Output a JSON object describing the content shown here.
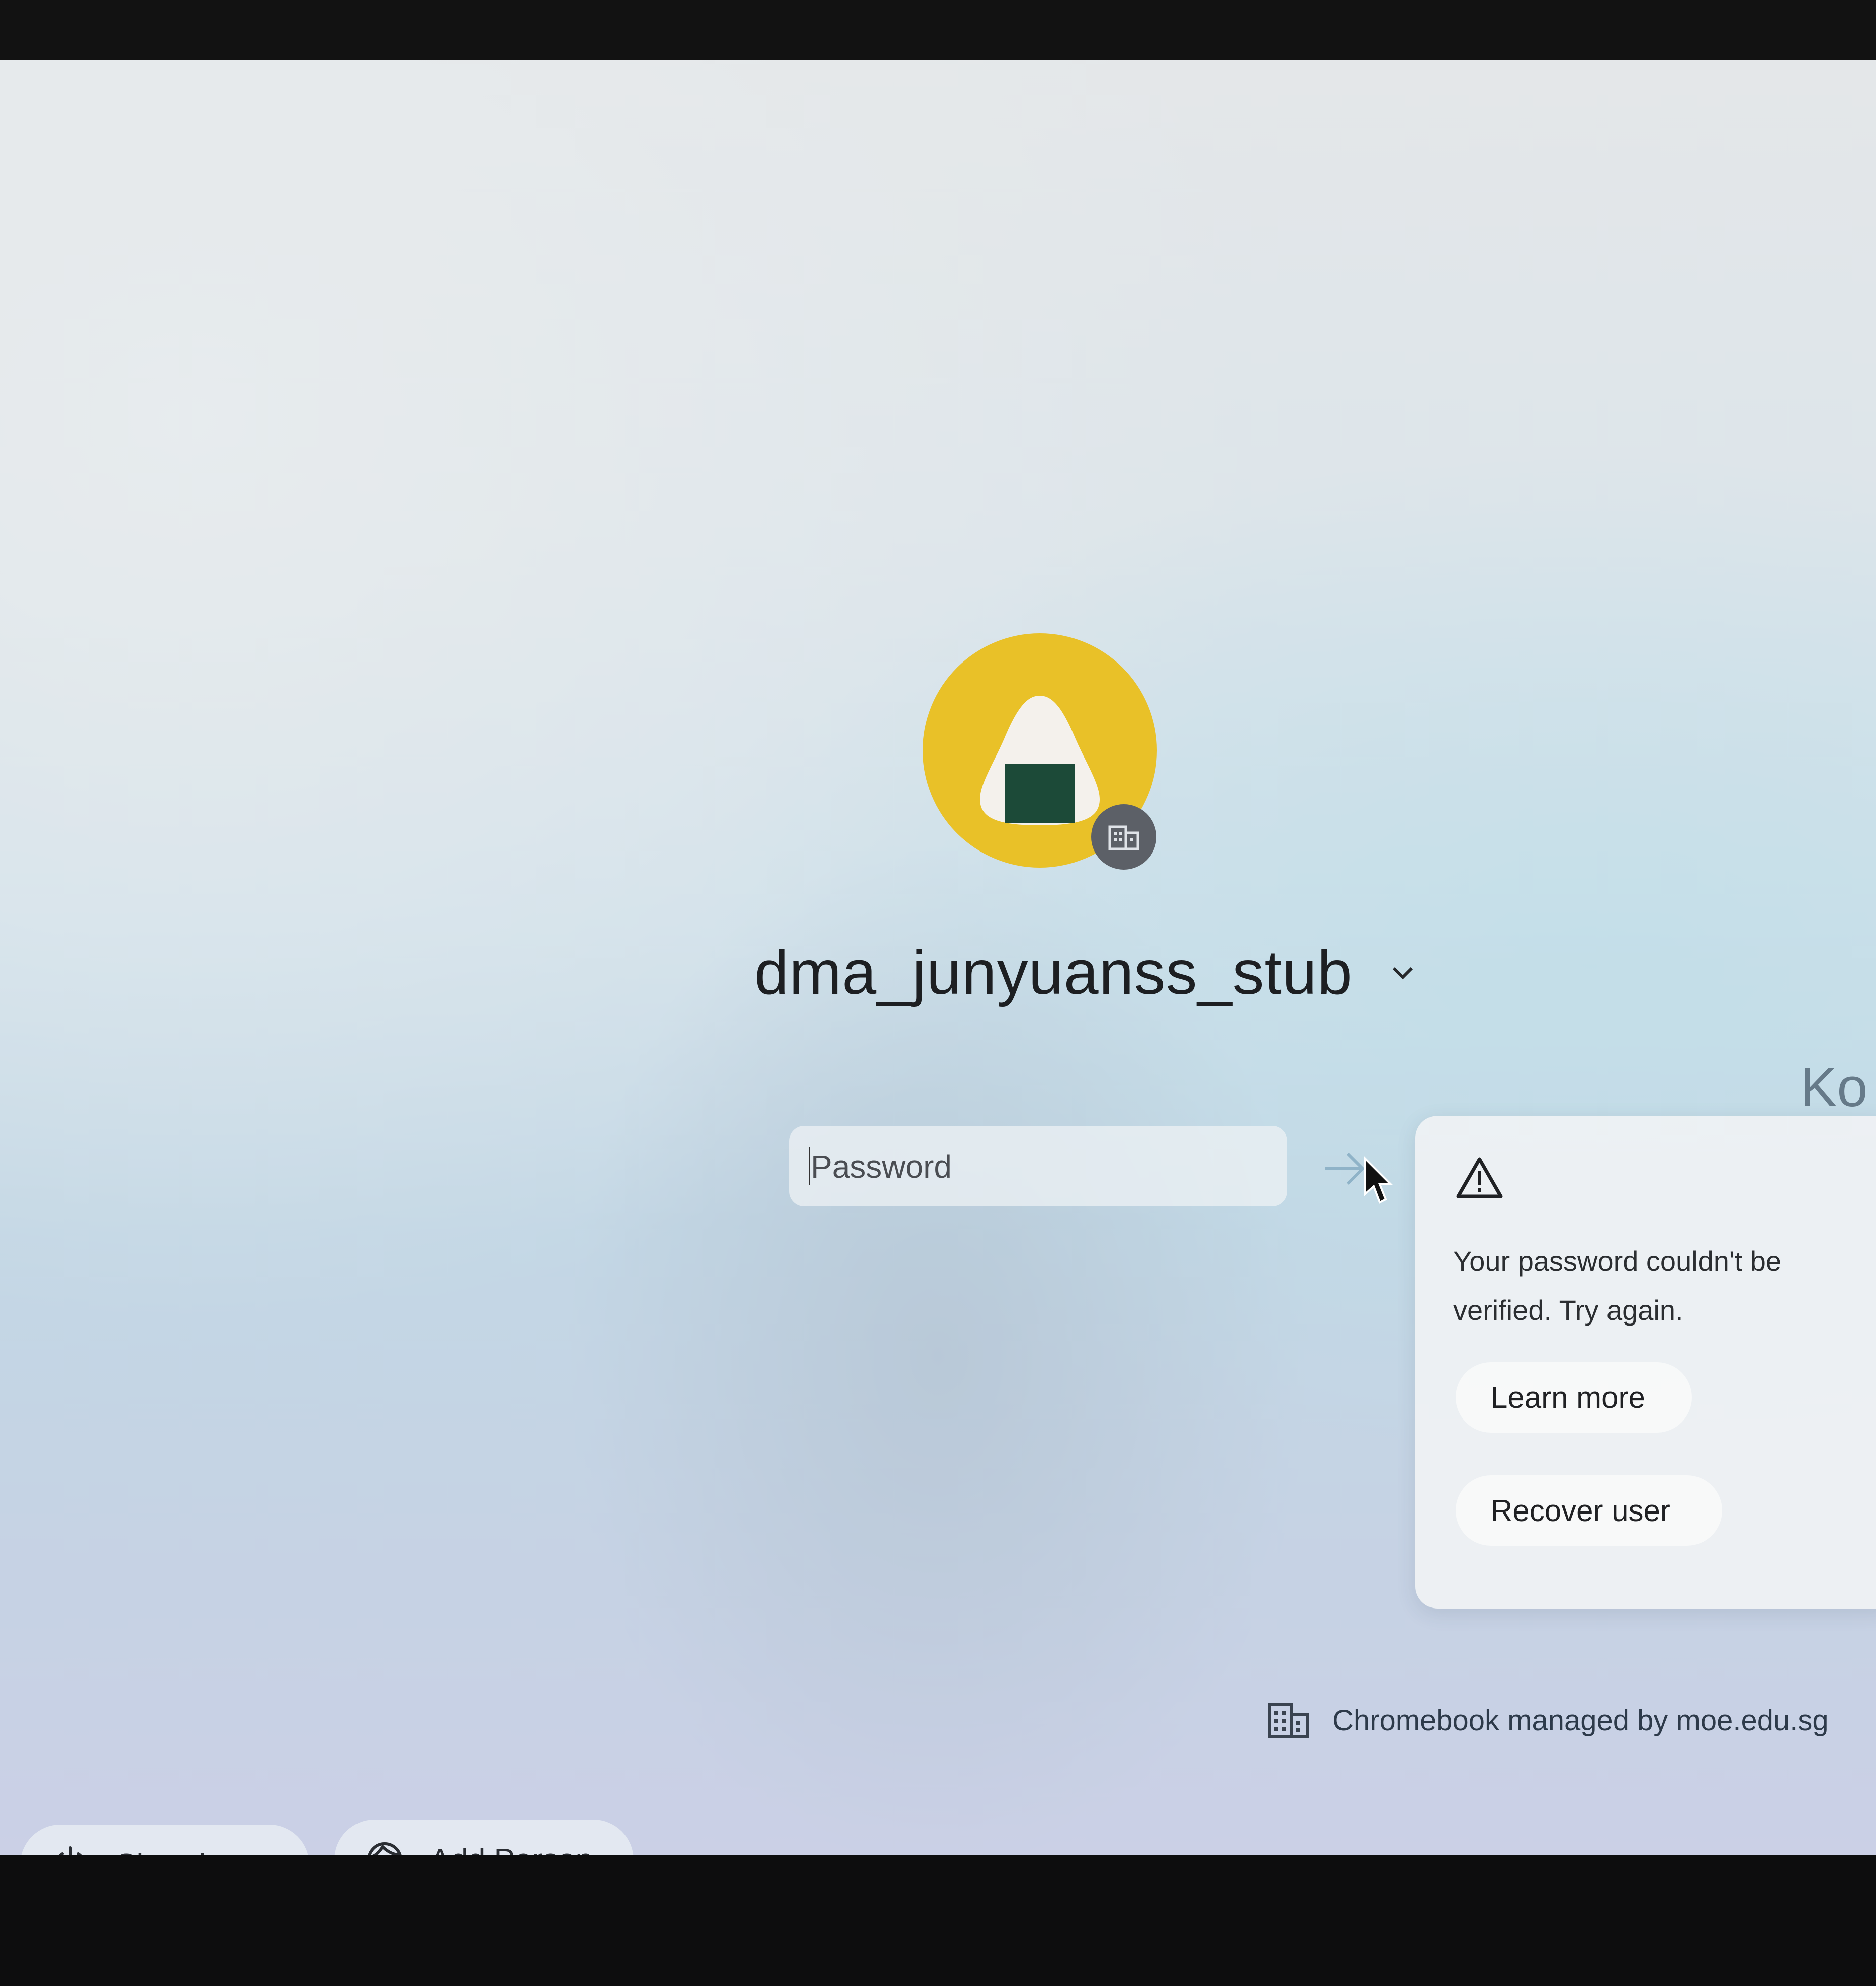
{
  "user": {
    "name": "dma_junyuanss_stub",
    "avatar_colors": {
      "background": "#e9c128",
      "rice": "#f4f1ec",
      "seaweed": "#1c4a38"
    },
    "badge_icon": "enterprise-building-icon"
  },
  "password": {
    "placeholder": "Password",
    "value": ""
  },
  "peek_user": "Ko",
  "error": {
    "icon": "warning-triangle-icon",
    "message": "Your password couldn't be verified. Try again.",
    "learn_more_label": "Learn more",
    "recover_user_label": "Recover user"
  },
  "managed_notice": {
    "icon": "building-icon",
    "text": "Chromebook managed by moe.edu.sg"
  },
  "shelf": {
    "shutdown_label": "Shut down",
    "add_person_label": "Add Person"
  }
}
